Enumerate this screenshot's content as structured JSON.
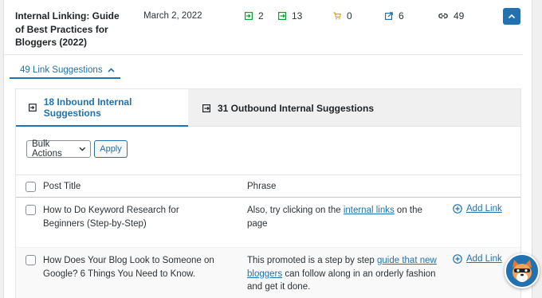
{
  "post": {
    "title": "Internal Linking: Guide of Best Practices for Bloggers (2022)",
    "date": "March 2, 2022",
    "stats": [
      {
        "icon": "inbound-link-icon",
        "value": "2",
        "color": "#00a32a"
      },
      {
        "icon": "outbound-link-icon",
        "value": "13",
        "color": "#00a32a"
      },
      {
        "icon": "orphan-cart-icon",
        "value": "0",
        "color": "#dba617"
      },
      {
        "icon": "external-link-icon",
        "value": "6",
        "color": "#2271b1"
      },
      {
        "icon": "chain-link-icon",
        "value": "49",
        "color": "#1d2327"
      }
    ]
  },
  "suggestions_toggle": "49 Link Suggestions",
  "tabs": {
    "inbound": "18 Inbound Internal Suggestions",
    "outbound": "31 Outbound Internal Suggestions"
  },
  "bulk": {
    "select_label": "Bulk Actions",
    "apply_label": "Apply"
  },
  "table": {
    "headers": {
      "post_title": "Post Title",
      "phrase": "Phrase"
    },
    "rows": [
      {
        "title": "How to Do Keyword Research for Beginners (Step-by-Step)",
        "phrase_before": "Also, try clicking on the ",
        "phrase_link": "internal links",
        "phrase_after": " on the page",
        "action": "Add Link"
      },
      {
        "title": "How Does Your Blog Look to Someone on Google? 6 Things You Need to Know.",
        "phrase_before": "This promoted is a step by step ",
        "phrase_link": "guide that new bloggers",
        "phrase_after": " can follow along in an orderly fashion and get it done.",
        "action": "Add Link"
      }
    ]
  },
  "colors": {
    "accent": "#2271b1",
    "green": "#00a32a",
    "orange": "#dba617"
  }
}
